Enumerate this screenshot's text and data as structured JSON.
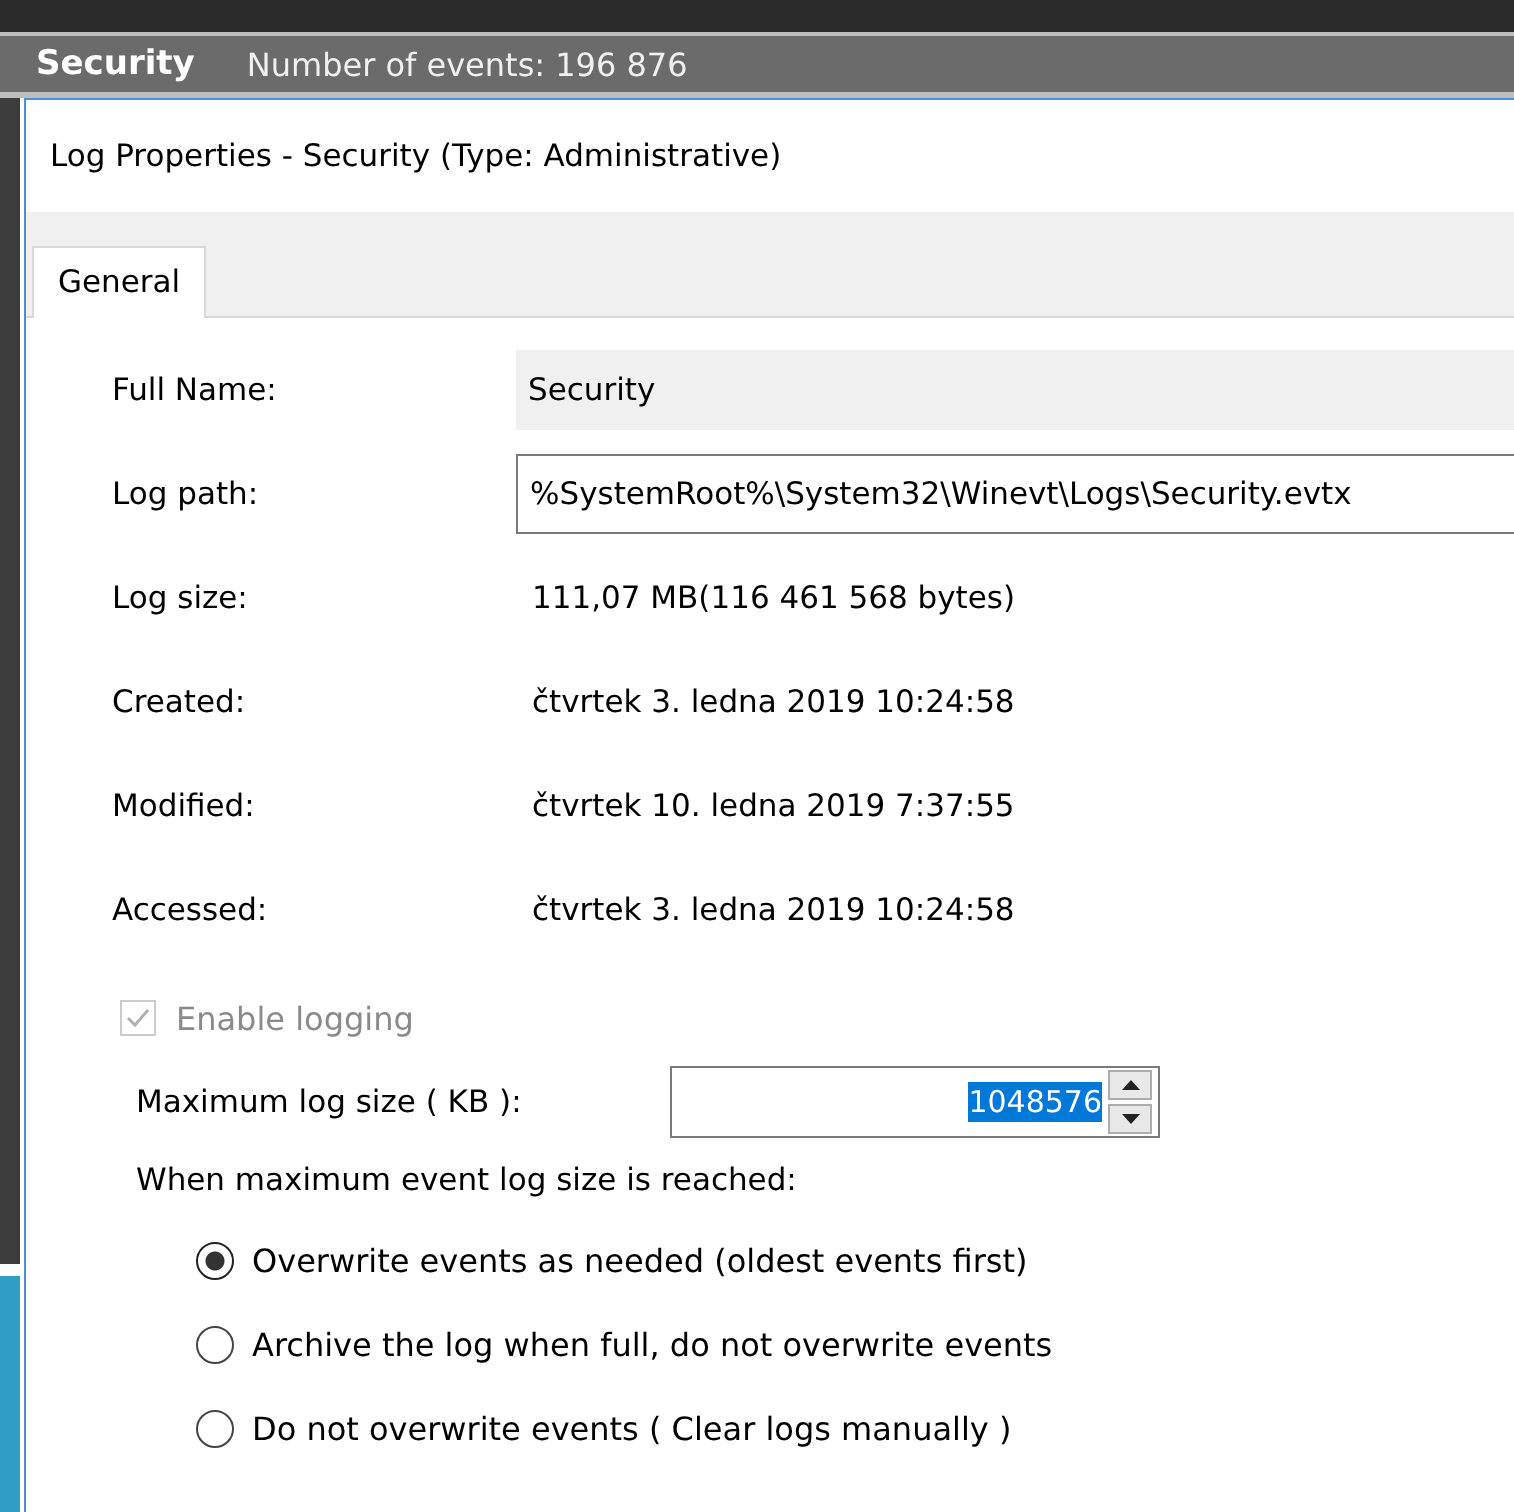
{
  "header": {
    "title": "Security",
    "subtitle": "Number of events: 196 876"
  },
  "dialog": {
    "title": "Log Properties - Security (Type: Administrative)"
  },
  "tabs": [
    {
      "label": "General",
      "selected": true
    }
  ],
  "properties": [
    {
      "label": "Full Name:",
      "value": "Security",
      "kind": "readonly"
    },
    {
      "label": "Log path:",
      "value": "%SystemRoot%\\System32\\Winevt\\Logs\\Security.evtx",
      "kind": "field"
    },
    {
      "label": "Log size:",
      "value": "111,07 MB(116 461 568 bytes)",
      "kind": "text"
    },
    {
      "label": "Created:",
      "value": "čtvrtek 3. ledna 2019 10:24:58",
      "kind": "text"
    },
    {
      "label": "Modified:",
      "value": "čtvrtek 10. ledna 2019 7:37:55",
      "kind": "text"
    },
    {
      "label": "Accessed:",
      "value": "čtvrtek 3. ledna 2019 10:24:58",
      "kind": "text"
    }
  ],
  "enable_logging": {
    "label": "Enable logging",
    "checked": true,
    "disabled": true
  },
  "max_size": {
    "label": "Maximum log size ( KB ):",
    "value": "1048576"
  },
  "policy": {
    "label": "When maximum event log size is reached:",
    "options": [
      {
        "label": "Overwrite events as needed (oldest events first)",
        "selected": true
      },
      {
        "label": "Archive the log when full, do not overwrite events",
        "selected": false
      },
      {
        "label": "Do not overwrite events ( Clear logs manually )",
        "selected": false
      }
    ]
  }
}
